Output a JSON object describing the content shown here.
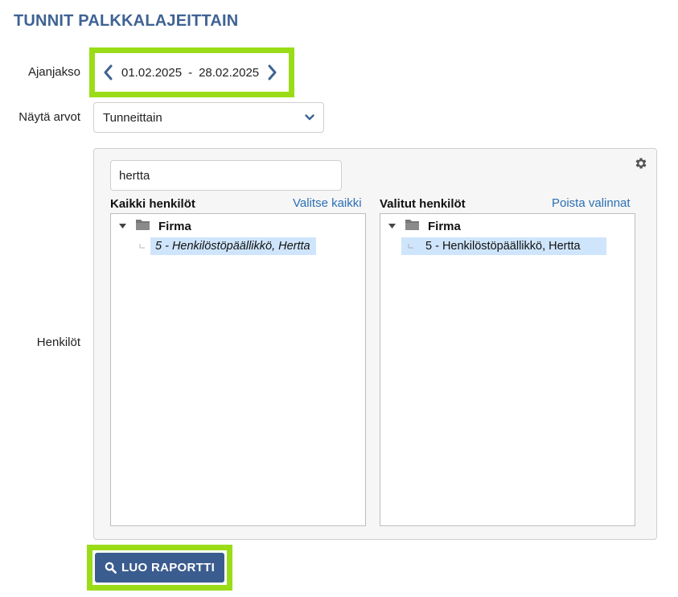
{
  "page": {
    "title": "TUNNIT PALKKALAJEITTAIN"
  },
  "period": {
    "label": "Ajanjakso",
    "start": "01.02.2025",
    "separator": "-",
    "end": "28.02.2025"
  },
  "display": {
    "label": "Näytä arvot",
    "selected": "Tunneittain"
  },
  "persons": {
    "label": "Henkilöt",
    "search_value": "hertta",
    "all": {
      "heading": "Kaikki henkilöt",
      "action": "Valitse kaikki",
      "folder": "Firma",
      "items": [
        "5 - Henkilöstöpäällikkö, Hertta"
      ]
    },
    "selected": {
      "heading": "Valitut henkilöt",
      "action": "Poista valinnat",
      "folder": "Firma",
      "items": [
        "5 - Henkilöstöpäällikkö, Hertta"
      ]
    }
  },
  "actions": {
    "create_report": "LUO RAPORTTI"
  },
  "colors": {
    "title": "#3f6294",
    "link": "#2c6fb5",
    "button": "#3b5c8f",
    "highlight": "#9bdc18",
    "selection": "#cfe5fb"
  },
  "icons": {
    "prev": "chevron-left-icon",
    "next": "chevron-right-icon",
    "dropdown": "chevron-down-icon",
    "settings": "gear-icon",
    "folder": "folder-icon",
    "search": "search-icon"
  }
}
